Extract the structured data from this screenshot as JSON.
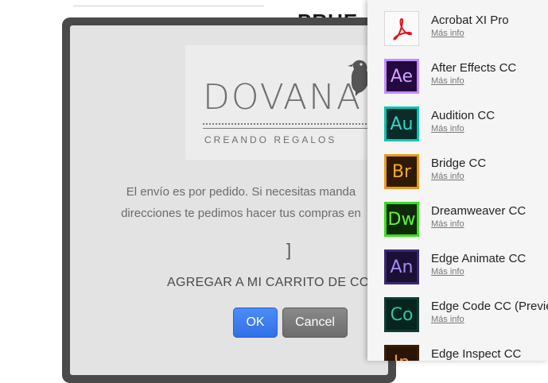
{
  "background": {
    "heading_fragment": "PRUE"
  },
  "modal": {
    "logo": {
      "word": "DOVANA",
      "tagline": "CREANDO REGALOS"
    },
    "message_line1": "El envío es por pedido. Si necesitas manda",
    "message_line2": "direcciones te pedimos hacer tus compras en",
    "bracket": "]",
    "title": "AGREGAR A MI CARRITO DE CO",
    "ok_label": "OK",
    "cancel_label": "Cancel"
  },
  "apps": [
    {
      "name": "Acrobat XI Pro",
      "link": "Más info",
      "abbr": "",
      "icon": "acrobat-icon",
      "fg": "#e3141b",
      "bg": "#fafafa",
      "border": "#d9d9d9"
    },
    {
      "name": "After Effects CC",
      "link": "Más info",
      "abbr": "Ae",
      "icon": "after-effects-icon",
      "fg": "#d4a2ff",
      "bg": "#23093f",
      "border": "#c48cff"
    },
    {
      "name": "Audition CC",
      "link": "Más info",
      "abbr": "Au",
      "icon": "audition-icon",
      "fg": "#31d6c6",
      "bg": "#0b2a28",
      "border": "#00c8b4"
    },
    {
      "name": "Bridge CC",
      "link": "Más info",
      "abbr": "Br",
      "icon": "bridge-icon",
      "fg": "#f8a82a",
      "bg": "#2f1a05",
      "border": "#e99a1a"
    },
    {
      "name": "Dreamweaver CC",
      "link": "Más info",
      "abbr": "Dw",
      "icon": "dreamweaver-icon",
      "fg": "#5ff53a",
      "bg": "#0e2a07",
      "border": "#35e01a"
    },
    {
      "name": "Edge Animate CC",
      "link": "Más info",
      "abbr": "An",
      "icon": "edge-animate-icon",
      "fg": "#a58bf0",
      "bg": "#1b0f36",
      "border": "#3a2870"
    },
    {
      "name": "Edge Code CC (Preview",
      "link": "Más info",
      "abbr": "Co",
      "icon": "edge-code-icon",
      "fg": "#2fc6a8",
      "bg": "#06251f",
      "border": "#0e3c33"
    },
    {
      "name": "Edge Inspect CC",
      "link": "",
      "abbr": "In",
      "icon": "edge-inspect-icon",
      "fg": "#f39a3a",
      "bg": "#2a1405",
      "border": "#3a1d06"
    }
  ]
}
